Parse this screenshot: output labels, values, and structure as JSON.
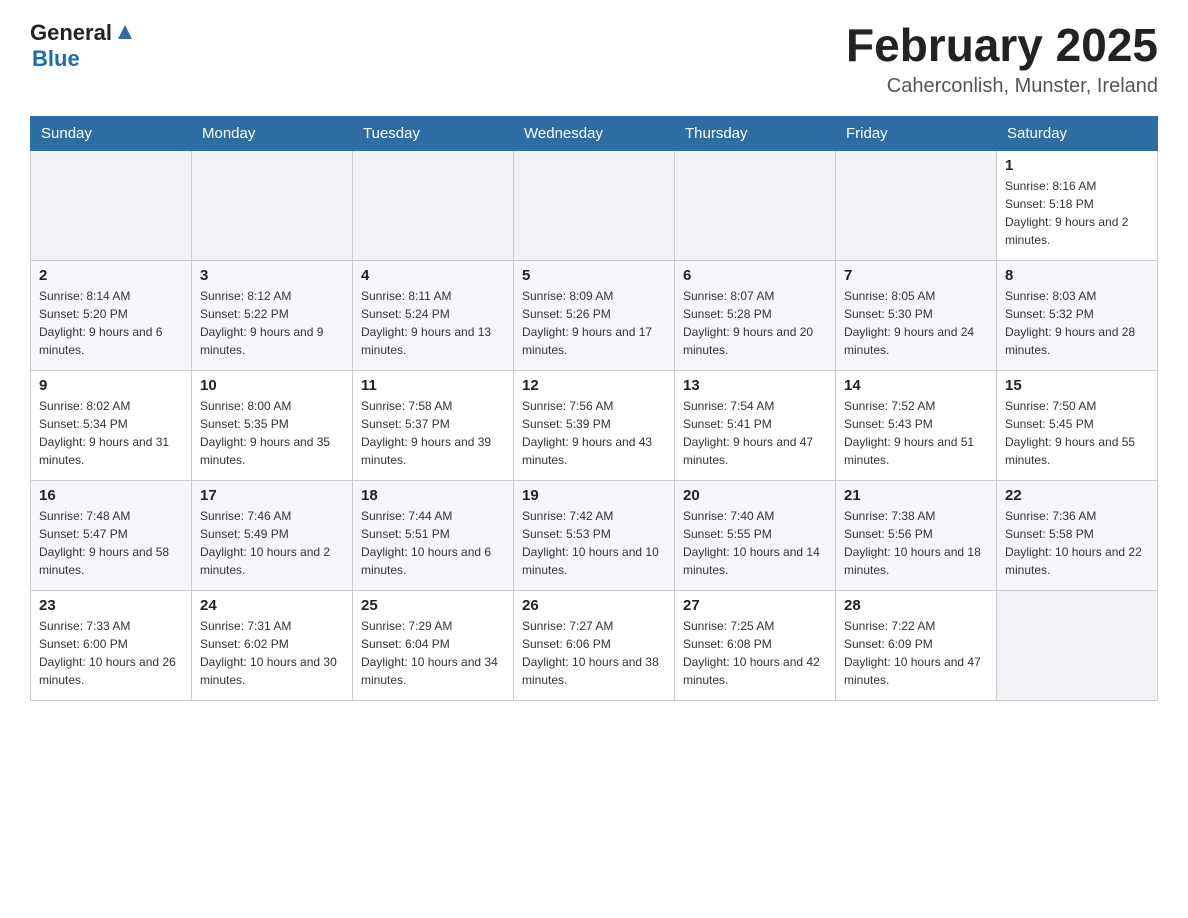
{
  "header": {
    "logo_general": "General",
    "logo_blue": "Blue",
    "month_title": "February 2025",
    "location": "Caherconlish, Munster, Ireland"
  },
  "days_of_week": [
    "Sunday",
    "Monday",
    "Tuesday",
    "Wednesday",
    "Thursday",
    "Friday",
    "Saturday"
  ],
  "weeks": [
    [
      {
        "day": "",
        "info": ""
      },
      {
        "day": "",
        "info": ""
      },
      {
        "day": "",
        "info": ""
      },
      {
        "day": "",
        "info": ""
      },
      {
        "day": "",
        "info": ""
      },
      {
        "day": "",
        "info": ""
      },
      {
        "day": "1",
        "info": "Sunrise: 8:16 AM\nSunset: 5:18 PM\nDaylight: 9 hours and 2 minutes."
      }
    ],
    [
      {
        "day": "2",
        "info": "Sunrise: 8:14 AM\nSunset: 5:20 PM\nDaylight: 9 hours and 6 minutes."
      },
      {
        "day": "3",
        "info": "Sunrise: 8:12 AM\nSunset: 5:22 PM\nDaylight: 9 hours and 9 minutes."
      },
      {
        "day": "4",
        "info": "Sunrise: 8:11 AM\nSunset: 5:24 PM\nDaylight: 9 hours and 13 minutes."
      },
      {
        "day": "5",
        "info": "Sunrise: 8:09 AM\nSunset: 5:26 PM\nDaylight: 9 hours and 17 minutes."
      },
      {
        "day": "6",
        "info": "Sunrise: 8:07 AM\nSunset: 5:28 PM\nDaylight: 9 hours and 20 minutes."
      },
      {
        "day": "7",
        "info": "Sunrise: 8:05 AM\nSunset: 5:30 PM\nDaylight: 9 hours and 24 minutes."
      },
      {
        "day": "8",
        "info": "Sunrise: 8:03 AM\nSunset: 5:32 PM\nDaylight: 9 hours and 28 minutes."
      }
    ],
    [
      {
        "day": "9",
        "info": "Sunrise: 8:02 AM\nSunset: 5:34 PM\nDaylight: 9 hours and 31 minutes."
      },
      {
        "day": "10",
        "info": "Sunrise: 8:00 AM\nSunset: 5:35 PM\nDaylight: 9 hours and 35 minutes."
      },
      {
        "day": "11",
        "info": "Sunrise: 7:58 AM\nSunset: 5:37 PM\nDaylight: 9 hours and 39 minutes."
      },
      {
        "day": "12",
        "info": "Sunrise: 7:56 AM\nSunset: 5:39 PM\nDaylight: 9 hours and 43 minutes."
      },
      {
        "day": "13",
        "info": "Sunrise: 7:54 AM\nSunset: 5:41 PM\nDaylight: 9 hours and 47 minutes."
      },
      {
        "day": "14",
        "info": "Sunrise: 7:52 AM\nSunset: 5:43 PM\nDaylight: 9 hours and 51 minutes."
      },
      {
        "day": "15",
        "info": "Sunrise: 7:50 AM\nSunset: 5:45 PM\nDaylight: 9 hours and 55 minutes."
      }
    ],
    [
      {
        "day": "16",
        "info": "Sunrise: 7:48 AM\nSunset: 5:47 PM\nDaylight: 9 hours and 58 minutes."
      },
      {
        "day": "17",
        "info": "Sunrise: 7:46 AM\nSunset: 5:49 PM\nDaylight: 10 hours and 2 minutes."
      },
      {
        "day": "18",
        "info": "Sunrise: 7:44 AM\nSunset: 5:51 PM\nDaylight: 10 hours and 6 minutes."
      },
      {
        "day": "19",
        "info": "Sunrise: 7:42 AM\nSunset: 5:53 PM\nDaylight: 10 hours and 10 minutes."
      },
      {
        "day": "20",
        "info": "Sunrise: 7:40 AM\nSunset: 5:55 PM\nDaylight: 10 hours and 14 minutes."
      },
      {
        "day": "21",
        "info": "Sunrise: 7:38 AM\nSunset: 5:56 PM\nDaylight: 10 hours and 18 minutes."
      },
      {
        "day": "22",
        "info": "Sunrise: 7:36 AM\nSunset: 5:58 PM\nDaylight: 10 hours and 22 minutes."
      }
    ],
    [
      {
        "day": "23",
        "info": "Sunrise: 7:33 AM\nSunset: 6:00 PM\nDaylight: 10 hours and 26 minutes."
      },
      {
        "day": "24",
        "info": "Sunrise: 7:31 AM\nSunset: 6:02 PM\nDaylight: 10 hours and 30 minutes."
      },
      {
        "day": "25",
        "info": "Sunrise: 7:29 AM\nSunset: 6:04 PM\nDaylight: 10 hours and 34 minutes."
      },
      {
        "day": "26",
        "info": "Sunrise: 7:27 AM\nSunset: 6:06 PM\nDaylight: 10 hours and 38 minutes."
      },
      {
        "day": "27",
        "info": "Sunrise: 7:25 AM\nSunset: 6:08 PM\nDaylight: 10 hours and 42 minutes."
      },
      {
        "day": "28",
        "info": "Sunrise: 7:22 AM\nSunset: 6:09 PM\nDaylight: 10 hours and 47 minutes."
      },
      {
        "day": "",
        "info": ""
      }
    ]
  ]
}
